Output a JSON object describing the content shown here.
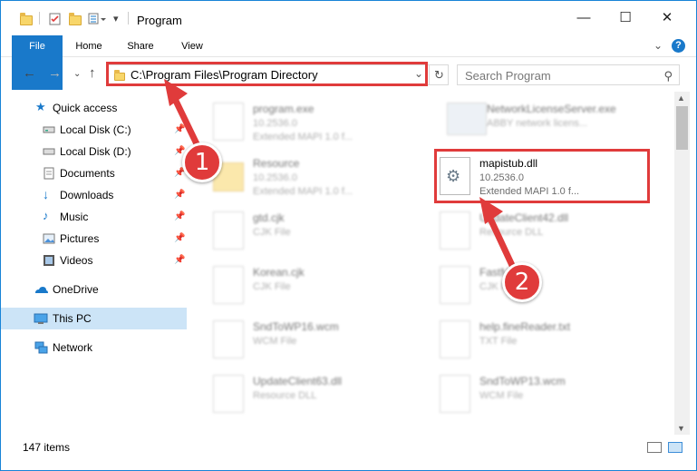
{
  "titlebar": {
    "title": "Program",
    "minimize": "—",
    "maximize": "☐",
    "close": "✕"
  },
  "ribbon": {
    "tabs": [
      "File",
      "Home",
      "Share",
      "View"
    ],
    "expand": "⌄",
    "help": "?"
  },
  "address": {
    "path": "C:\\Program Files\\Program Directory",
    "search_placeholder": "Search Program"
  },
  "sidebar": {
    "items": [
      {
        "label": "Quick access",
        "icon": "star-icon"
      },
      {
        "label": "Local Disk (C:)",
        "icon": "drive-icon",
        "pinned": true
      },
      {
        "label": "Local Disk (D:)",
        "icon": "drive-icon",
        "pinned": true
      },
      {
        "label": "Documents",
        "icon": "documents-icon",
        "pinned": true
      },
      {
        "label": "Downloads",
        "icon": "downloads-icon",
        "pinned": true
      },
      {
        "label": "Music",
        "icon": "music-icon",
        "pinned": true
      },
      {
        "label": "Pictures",
        "icon": "pictures-icon",
        "pinned": true
      },
      {
        "label": "Videos",
        "icon": "videos-icon",
        "pinned": true
      },
      {
        "label": "OneDrive",
        "icon": "onedrive-icon"
      },
      {
        "label": "This PC",
        "icon": "pc-icon",
        "selected": true
      },
      {
        "label": "Network",
        "icon": "network-icon"
      }
    ]
  },
  "files": [
    {
      "name": "program.exe",
      "line1": "10.2536.0",
      "line2": "Extended MAPI 1.0 f..."
    },
    {
      "name": "NetworkLicenseServer.exe",
      "line1": "ABBY network licens...",
      "line2": ""
    },
    {
      "name": "Resource",
      "line1": "10.2536.0",
      "line2": "Extended MAPI 1.0 f..."
    },
    {
      "name": "mapistub.dll",
      "line1": "10.2536.0",
      "line2": "Extended MAPI 1.0 f..."
    },
    {
      "name": "gtd.cjk",
      "line1": "CJK File",
      "line2": ""
    },
    {
      "name": "UpdateClient42.dll",
      "line1": "Resource DLL",
      "line2": ""
    },
    {
      "name": "Korean.cjk",
      "line1": "CJK File",
      "line2": ""
    },
    {
      "name": "FastMod.cjk",
      "line1": "CJK File",
      "line2": ""
    },
    {
      "name": "SndToWP16.wcm",
      "line1": "WCM File",
      "line2": ""
    },
    {
      "name": "help.fineReader.txt",
      "line1": "TXT File",
      "line2": ""
    },
    {
      "name": "UpdateClient63.dll",
      "line1": "Resource DLL",
      "line2": ""
    },
    {
      "name": "SndToWP13.wcm",
      "line1": "WCM File",
      "line2": ""
    }
  ],
  "status": {
    "count": "147 items"
  },
  "annotations": {
    "step1": "1",
    "step2": "2"
  },
  "colors": {
    "accent": "#1979ca",
    "highlight": "#e03b3b",
    "selected": "#cce4f7"
  }
}
